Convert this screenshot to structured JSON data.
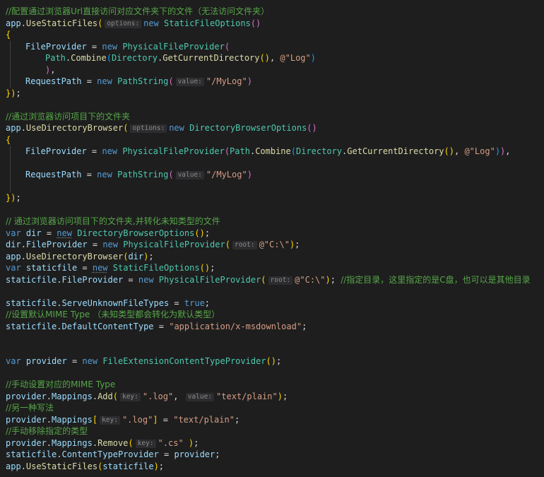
{
  "comments": {
    "c1": "//配置通过浏览器Url直接访问对应文件夹下的文件（无法访问文件夹）",
    "c2": "//通过浏览器访问项目下的文件夹",
    "c3": "// 通过浏览器访问项目下的文件夹,并转化未知类型的文件",
    "c4": "//指定目录，这里指定的是C盘，也可以是其他目录",
    "c5": "//设置默认MIME Type （未知类型都会转化为默认类型）",
    "c6": "//手动设置对应的MIME Type",
    "c7": "//另一种写法",
    "c8": "//手动移除指定的类型"
  },
  "hints": {
    "options": "options:",
    "value": "value:",
    "root": "root:",
    "key": "key:"
  },
  "kw": {
    "new": "new",
    "var": "var",
    "true": "true"
  },
  "id": {
    "app": "app",
    "UseStaticFiles": "UseStaticFiles",
    "StaticFileOptions": "StaticFileOptions",
    "FileProvider": "FileProvider",
    "PhysicalFileProvider": "PhysicalFileProvider",
    "Path": "Path",
    "Combine": "Combine",
    "Directory": "Directory",
    "GetCurrentDirectory": "GetCurrentDirectory",
    "RequestPath": "RequestPath",
    "PathString": "PathString",
    "UseDirectoryBrowser": "UseDirectoryBrowser",
    "DirectoryBrowserOptions": "DirectoryBrowserOptions",
    "dir": "dir",
    "staticfile": "staticfile",
    "ServeUnknownFileTypes": "ServeUnknownFileTypes",
    "DefaultContentType": "DefaultContentType",
    "provider": "provider",
    "FileExtensionContentTypeProvider": "FileExtensionContentTypeProvider",
    "Mappings": "Mappings",
    "Add": "Add",
    "Remove": "Remove",
    "ContentTypeProvider": "ContentTypeProvider"
  },
  "str": {
    "log_at": "@\"Log\"",
    "mylog": "\"/MyLog\"",
    "cdrive": "@\"C:\\\"",
    "msdownload": "\"application/x-msdownload\"",
    "dotlog": "\".log\"",
    "textplain": "\"text/plain\"",
    "dotcs": "\".cs\""
  }
}
